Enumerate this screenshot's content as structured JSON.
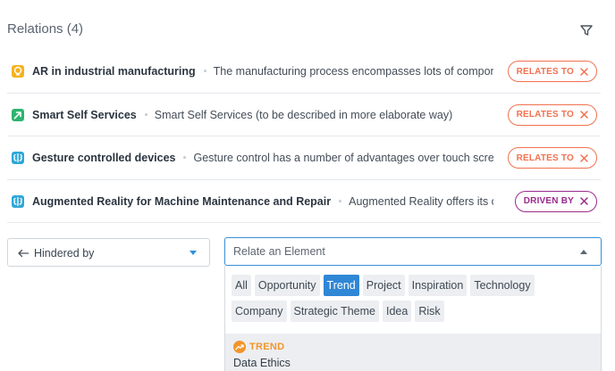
{
  "header": {
    "title": "Relations (4)",
    "filter_icon": "filter-icon"
  },
  "relations": [
    {
      "icon": "bulb-icon",
      "icon_color": "#f6b21f",
      "name": "AR in industrial manufacturing",
      "description": "The manufacturing process encompasses lots of components....",
      "relation": "RELATES TO",
      "relation_color": "#f2714f"
    },
    {
      "icon": "arrow-box-icon",
      "icon_color": "#2db46f",
      "name": "Smart Self Services",
      "description": "Smart Self Services (to be described in more elaborate way)",
      "relation": "RELATES TO",
      "relation_color": "#f2714f"
    },
    {
      "icon": "brain-icon",
      "icon_color": "#2ea7d8",
      "name": "Gesture controlled devices",
      "description": "Gesture control has a number of advantages over touch screens: ...",
      "relation": "RELATES TO",
      "relation_color": "#f2714f"
    },
    {
      "icon": "brain-icon",
      "icon_color": "#2ea7d8",
      "name": "Augmented Reality for Machine Maintenance and Repair",
      "description": "Augmented Reality offers its custo...",
      "relation": "DRIVEN BY",
      "relation_color": "#9a2a8c"
    }
  ],
  "direction_select": {
    "value": "Hindered by"
  },
  "search": {
    "placeholder": "Relate an Element"
  },
  "filters": [
    {
      "label": "All",
      "active": false
    },
    {
      "label": "Opportunity",
      "active": false
    },
    {
      "label": "Trend",
      "active": true
    },
    {
      "label": "Project",
      "active": false
    },
    {
      "label": "Inspiration",
      "active": false
    },
    {
      "label": "Technology",
      "active": false
    },
    {
      "label": "Company",
      "active": false
    },
    {
      "label": "Strategic Theme",
      "active": false
    },
    {
      "label": "Idea",
      "active": false
    },
    {
      "label": "Risk",
      "active": false
    }
  ],
  "result": {
    "type": "TREND",
    "name": "Data Ethics",
    "type_color": "#f3952b"
  }
}
